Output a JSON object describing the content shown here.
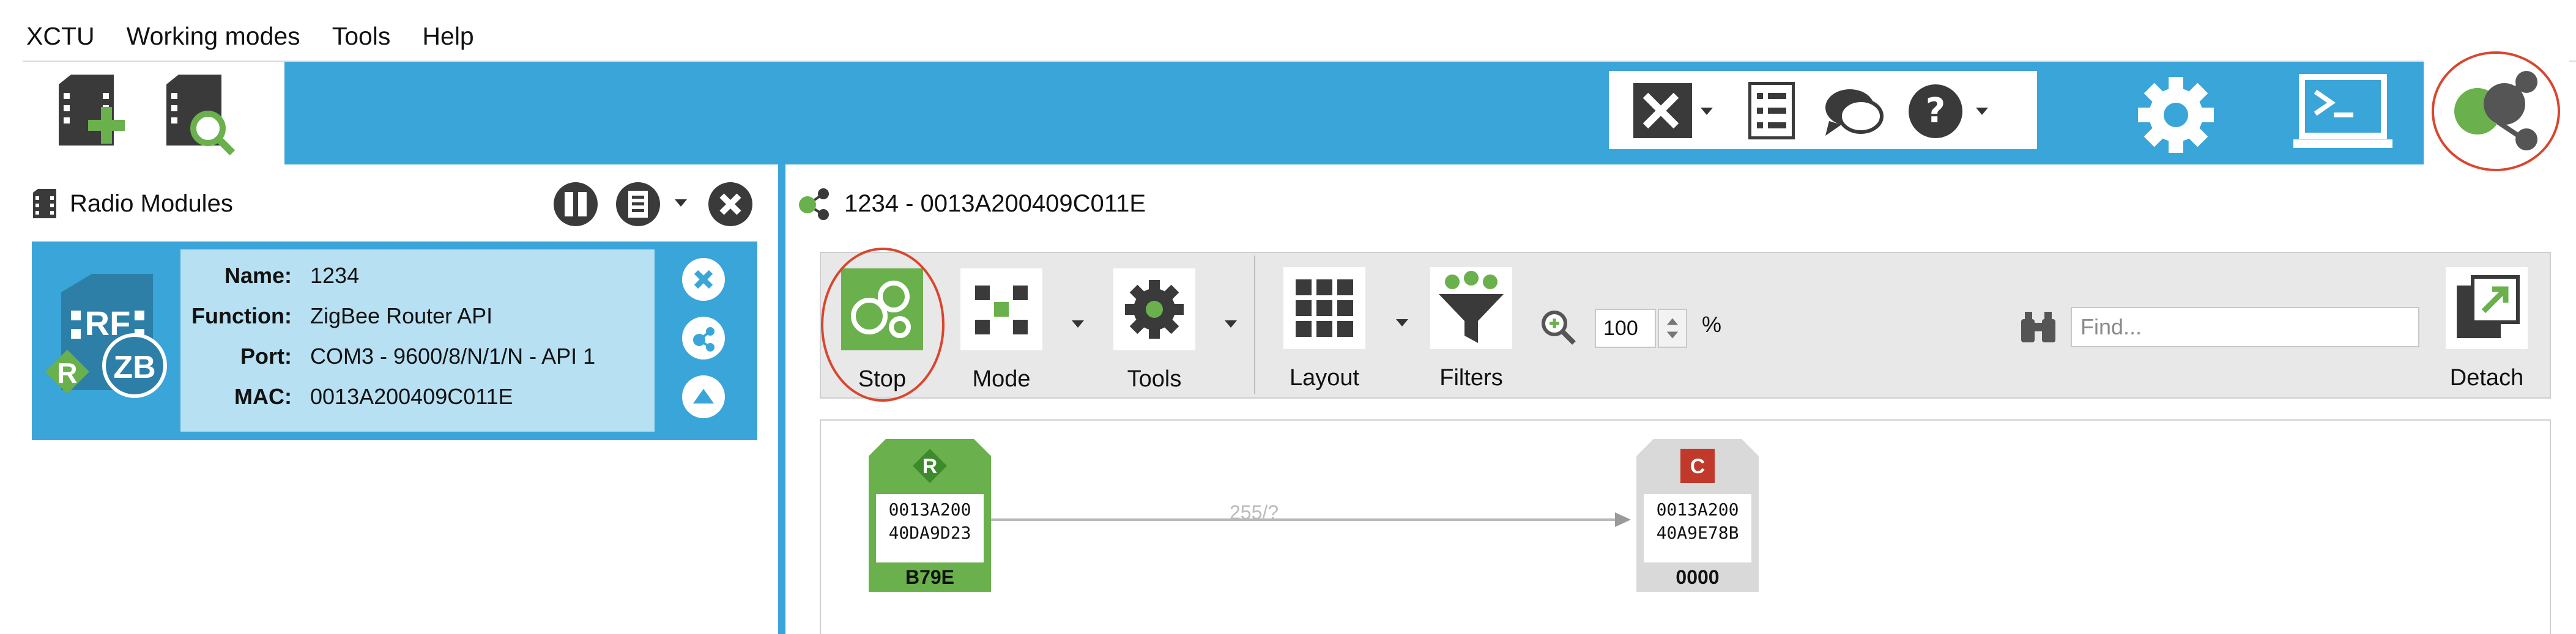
{
  "menu": [
    "XCTU",
    "Working modes",
    "Tools",
    "Help"
  ],
  "toolbar": {
    "left_icons": [
      "add-module-icon",
      "discover-modules-icon"
    ],
    "right_icons": [
      "tools-icon",
      "frames-generator-icon",
      "chat-icon",
      "help-icon",
      "configuration-working-mode-icon",
      "consoles-working-mode-icon",
      "network-working-mode-icon"
    ]
  },
  "radio_modules": {
    "title": "Radio Modules",
    "module": {
      "labels": {
        "name": "Name:",
        "function": "Function:",
        "port": "Port:",
        "mac": "MAC:"
      },
      "name": "1234",
      "function": "ZigBee Router API",
      "port": "COM3 - 9600/8/N/1/N - API 1",
      "mac": "0013A200409C011E",
      "badge_rf": "RF",
      "badge_r": "R",
      "badge_zb": "ZB"
    }
  },
  "network": {
    "title": "1234 - 0013A200409C011E",
    "toolbar": {
      "stop": "Stop",
      "mode": "Mode",
      "tools": "Tools",
      "layout": "Layout",
      "filters": "Filters",
      "zoom_value": "100",
      "zoom_unit": "%",
      "find_placeholder": "Find...",
      "detach": "Detach"
    },
    "nodes": [
      {
        "role_letter": "R",
        "id_line1": "0013A200",
        "id_line2": "40DA9D23",
        "short": "B79E",
        "color": "#6ab04c"
      },
      {
        "role_letter": "C",
        "id_line1": "0013A200",
        "id_line2": "40A9E78B",
        "short": "0000",
        "color": "#d9d9d9"
      }
    ],
    "link_label": "255/?"
  },
  "colors": {
    "accent": "#3aa5d8",
    "router_green": "#6ab04c",
    "coordinator_red": "#c0392b",
    "highlight": "#d9462e"
  }
}
